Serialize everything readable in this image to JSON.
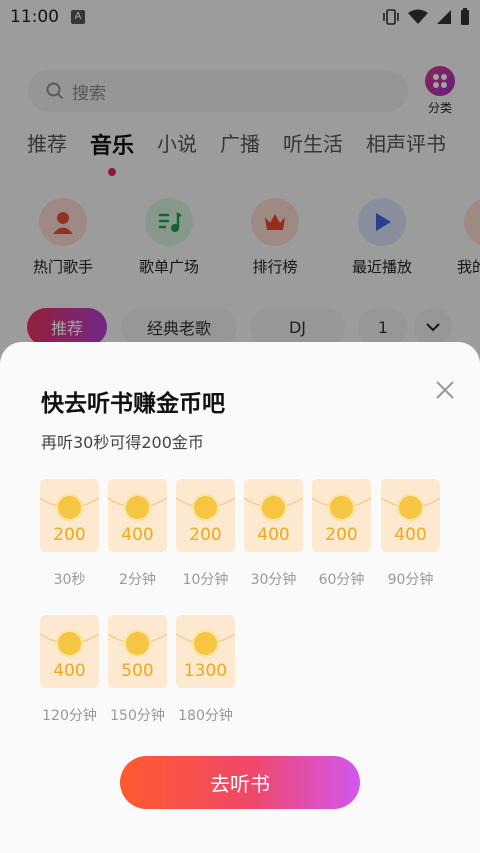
{
  "status": {
    "time": "11:00",
    "notif_icon": "A"
  },
  "search": {
    "placeholder": "搜索"
  },
  "category": {
    "label": "分类"
  },
  "tabs": [
    {
      "label": "推荐"
    },
    {
      "label": "音乐",
      "active": true
    },
    {
      "label": "小说"
    },
    {
      "label": "广播"
    },
    {
      "label": "听生活"
    },
    {
      "label": "相声评书"
    }
  ],
  "quick": [
    {
      "label": "热门歌手",
      "icon": "singer-icon"
    },
    {
      "label": "歌单广场",
      "icon": "playlist-icon"
    },
    {
      "label": "排行榜",
      "icon": "crown-icon"
    },
    {
      "label": "最近播放",
      "icon": "play-icon"
    },
    {
      "label": "我的",
      "icon": "user-icon"
    }
  ],
  "chips": [
    {
      "label": "推荐",
      "active": true
    },
    {
      "label": "经典老歌"
    },
    {
      "label": "DJ"
    },
    {
      "label": "1"
    }
  ],
  "sheet": {
    "title": "快去听书赚金币吧",
    "subtitle": "再听30秒可得200金币",
    "rewards": [
      {
        "amount": "200",
        "label": "30秒"
      },
      {
        "amount": "400",
        "label": "2分钟"
      },
      {
        "amount": "200",
        "label": "10分钟"
      },
      {
        "amount": "400",
        "label": "30分钟"
      },
      {
        "amount": "200",
        "label": "60分钟"
      },
      {
        "amount": "400",
        "label": "90分钟"
      },
      {
        "amount": "400",
        "label": "120分钟"
      },
      {
        "amount": "500",
        "label": "150分钟"
      },
      {
        "amount": "1300",
        "label": "180分钟"
      }
    ],
    "cta_label": "去听书"
  },
  "colors": {
    "accent": "#e0245e",
    "coin": "#f6c642",
    "amount": "#f0a81c",
    "card": "#fde9cf"
  }
}
